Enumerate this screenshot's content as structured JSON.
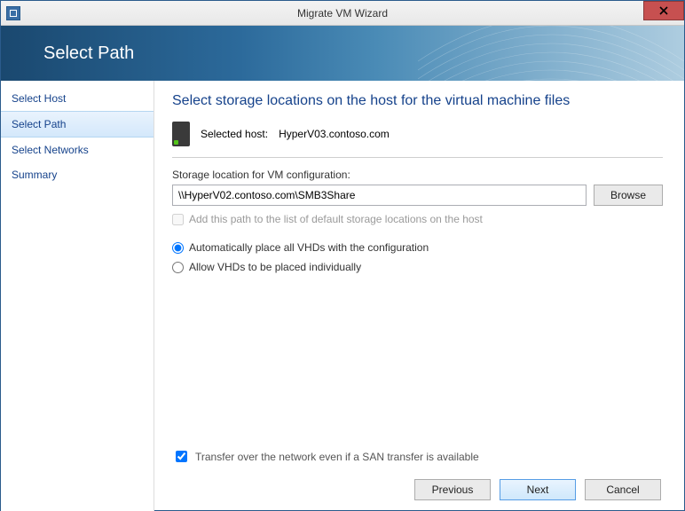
{
  "window": {
    "title": "Migrate VM Wizard"
  },
  "header": {
    "title": "Select Path"
  },
  "sidebar": {
    "items": [
      {
        "label": "Select Host"
      },
      {
        "label": "Select Path"
      },
      {
        "label": "Select Networks"
      },
      {
        "label": "Summary"
      }
    ],
    "active_index": 1
  },
  "main": {
    "heading": "Select storage locations on the host for the virtual machine files",
    "selected_host_label": "Selected host:",
    "selected_host_value": "HyperV03.contoso.com",
    "storage_label": "Storage location for VM configuration:",
    "storage_value": "\\\\HyperV02.contoso.com\\SMB3Share",
    "browse_button": "Browse",
    "add_default_checkbox": {
      "label": "Add this path to the list of default storage locations on the host",
      "checked": false,
      "enabled": false
    },
    "placement": {
      "options": [
        "Automatically place all VHDs with the configuration",
        "Allow VHDs to be placed individually"
      ],
      "selected_index": 0
    },
    "transfer_checkbox": {
      "label": "Transfer over the network even if a SAN transfer is available",
      "checked": true
    }
  },
  "footer": {
    "previous": "Previous",
    "next": "Next",
    "cancel": "Cancel"
  }
}
